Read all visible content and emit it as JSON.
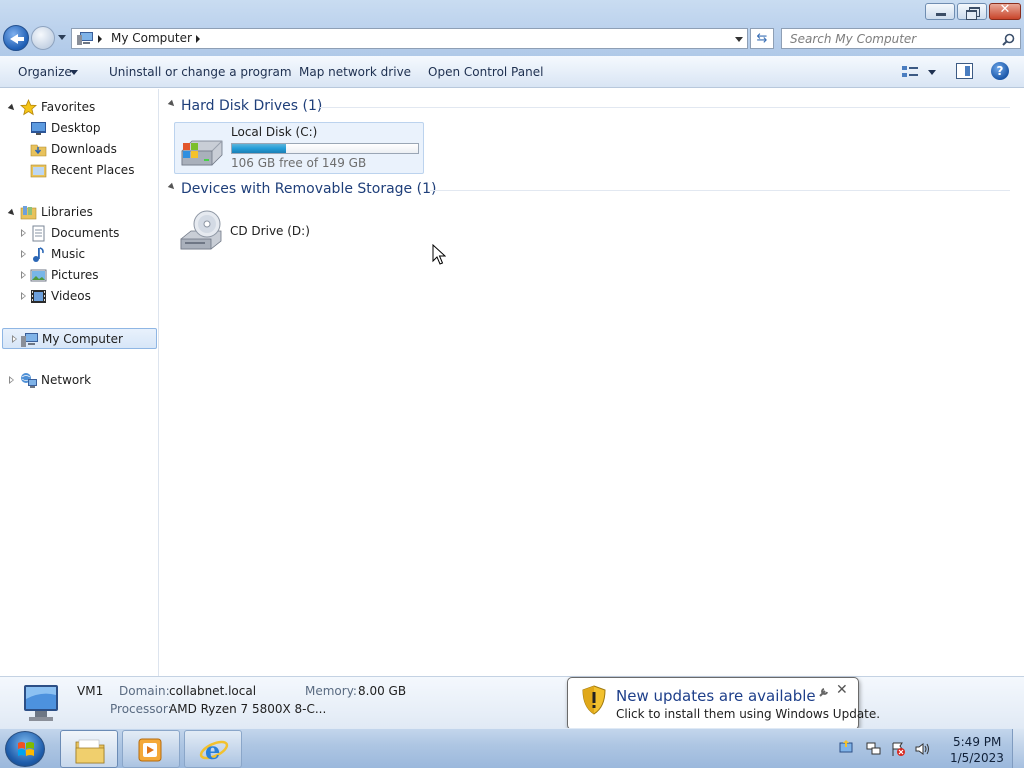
{
  "window": {
    "address_path": "My Computer",
    "search_placeholder": "Search My Computer"
  },
  "commands": {
    "organize": "Organize",
    "uninstall": "Uninstall or change a program",
    "map_drive": "Map network drive",
    "control_panel": "Open Control Panel"
  },
  "nav": {
    "favorites": "Favorites",
    "desktop": "Desktop",
    "downloads": "Downloads",
    "recent": "Recent Places",
    "libraries": "Libraries",
    "documents": "Documents",
    "music": "Music",
    "pictures": "Pictures",
    "videos": "Videos",
    "my_computer": "My Computer",
    "network": "Network"
  },
  "groups": {
    "hdd_header": "Hard Disk Drives (1)",
    "removable_header": "Devices with Removable Storage (1)"
  },
  "drives": {
    "c_name": "Local Disk (C:)",
    "c_free": "106 GB free of 149 GB",
    "c_used_fraction": 0.29,
    "d_name": "CD Drive (D:)"
  },
  "details": {
    "computer_name": "VM1",
    "domain_label": "Domain:",
    "domain_value": "collabnet.local",
    "memory_label": "Memory:",
    "memory_value": "8.00 GB",
    "processor_label": "Processor:",
    "processor_value": "AMD Ryzen 7 5800X 8-C..."
  },
  "notification": {
    "title": "New updates are available",
    "message": "Click to install them using Windows Update."
  },
  "taskbar": {
    "time": "5:49 PM",
    "date": "1/5/2023"
  },
  "colors": {
    "accent": "#1f3f7a",
    "progress": "#26a0da",
    "selection": "#d7e6f8"
  }
}
